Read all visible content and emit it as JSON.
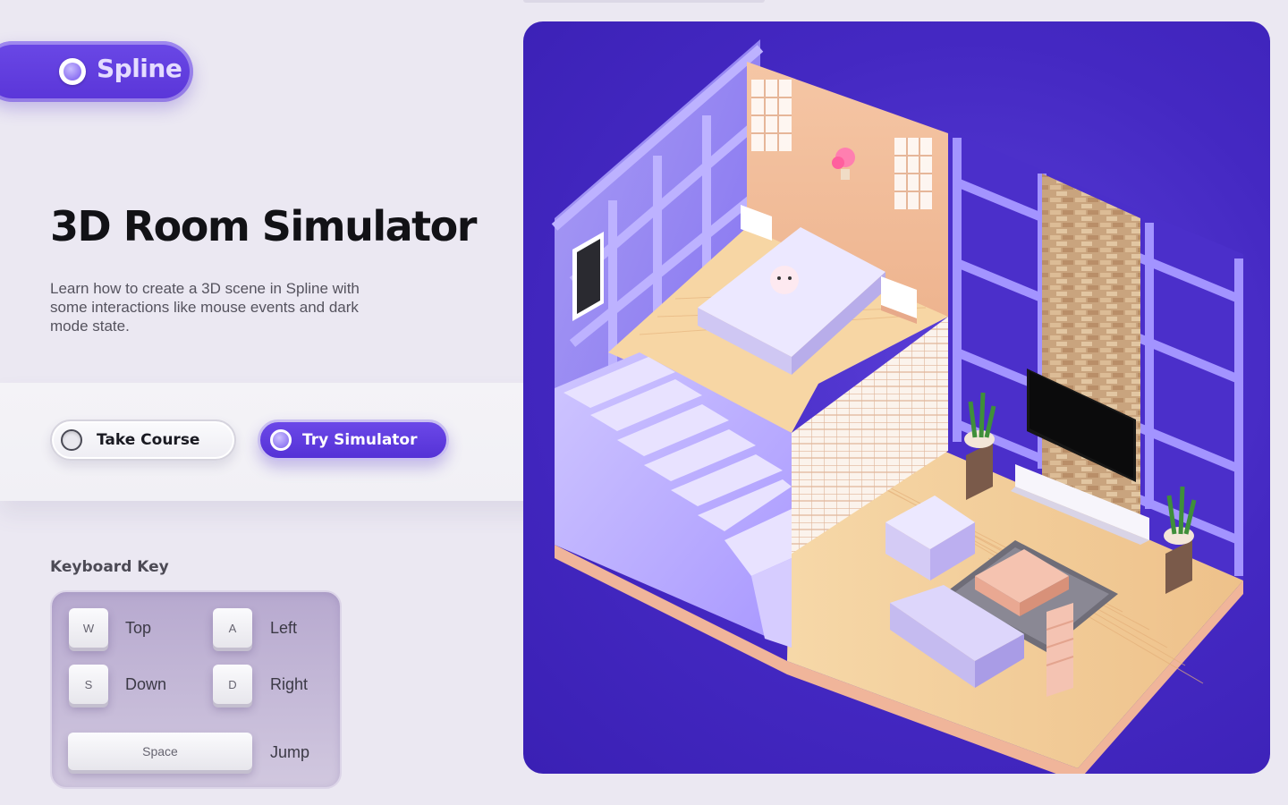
{
  "brand": {
    "name": "Spline"
  },
  "hero": {
    "title": "3D Room Simulator",
    "description": "Learn how to create a 3D scene in Spline with some interactions like mouse events and dark mode state."
  },
  "actions": {
    "take_course": "Take Course",
    "try_simulator": "Try Simulator"
  },
  "keyboard": {
    "heading": "Keyboard Key",
    "keys": [
      {
        "key": "W",
        "action": "Top"
      },
      {
        "key": "A",
        "action": "Left"
      },
      {
        "key": "S",
        "action": "Down"
      },
      {
        "key": "D",
        "action": "Right"
      },
      {
        "key": "Space",
        "action": "Jump"
      }
    ]
  },
  "colors": {
    "accent": "#5a35d8",
    "scene_background": "#4428c2",
    "page_background": "#ebe8f2",
    "wall": "#9d8ff0",
    "floor": "#f0c894"
  },
  "icons": {
    "logo": "spline-ring-icon",
    "course_button": "radio-ring-icon",
    "simulator_button": "radio-ring-icon",
    "panel_arrow": "chevron-right-icon"
  }
}
